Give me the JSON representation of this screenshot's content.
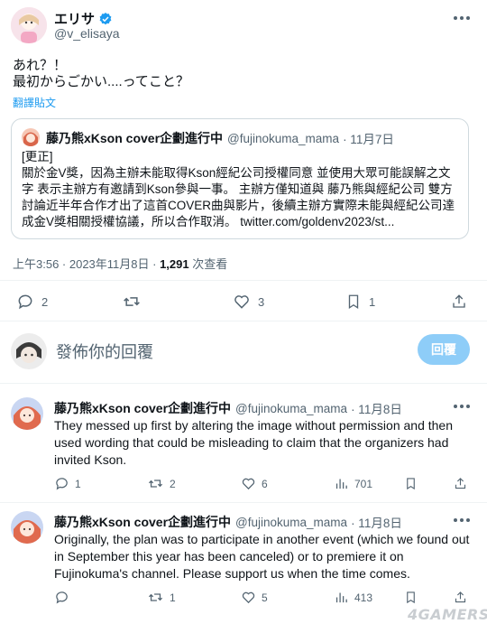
{
  "post": {
    "author_name": "エリサ",
    "author_handle": "@v_elisaya",
    "text_line1": "あれ？！",
    "text_line2": "最初からごかい....ってこと？",
    "translate_label": "翻譯貼文",
    "quote": {
      "author_name": "藤乃熊xKson cover企劃進行中",
      "author_handle": "@fujinokuma_mama",
      "date": "· 11月7日",
      "line1": "[更正]",
      "line2": "關於金V獎，因為主辦未能取得Kson經紀公司授權同意 並使用大眾可能誤解之文",
      "line3": "字 表示主辦方有邀請到Kson參與一事。 主辦方僅知道與 藤乃熊與經紀公司 雙方",
      "line4": "討論近半年合作才出了這首COVER曲與影片，後續主辦方實際未能與經紀公司達",
      "line5": "成金V獎相關授權協議，所以合作取消。 twitter.com/goldenv2023/st..."
    },
    "timestamp": "上午3:56 · 2023年11月8日 · ",
    "views_count": "1,291",
    "views_label": " 次查看",
    "replies": "2",
    "retweets": "",
    "likes": "3",
    "bookmarks": "1"
  },
  "reply_box": {
    "placeholder": "發佈你的回覆",
    "button": "回覆"
  },
  "replies": [
    {
      "author_name": "藤乃熊xKson cover企劃進行中",
      "author_handle": "@fujinokuma_mama",
      "date": "· 11月8日",
      "line1": "They messed up first by altering the image without permission and then",
      "line2": "used wording that could be misleading to claim that the organizers had",
      "line3": "invited Kson.",
      "line4": "",
      "replies": "1",
      "retweets": "2",
      "likes": "6",
      "views": "701"
    },
    {
      "author_name": "藤乃熊xKson cover企劃進行中",
      "author_handle": "@fujinokuma_mama",
      "date": "· 11月8日",
      "line1": "Originally, the plan was to participate in another event (which we found out",
      "line2": "in September this year has been canceled) or to premiere it on",
      "line3": "Fujinokuma's channel. Please support us when the time comes.",
      "line4": "",
      "replies": "",
      "retweets": "1",
      "likes": "5",
      "views": "413"
    }
  ],
  "watermark": "4GAMERS",
  "colors": {
    "accent": "#1d9bf0",
    "muted": "#536471",
    "reply_button": "#8ecdf8",
    "divider": "#eff3f4"
  }
}
